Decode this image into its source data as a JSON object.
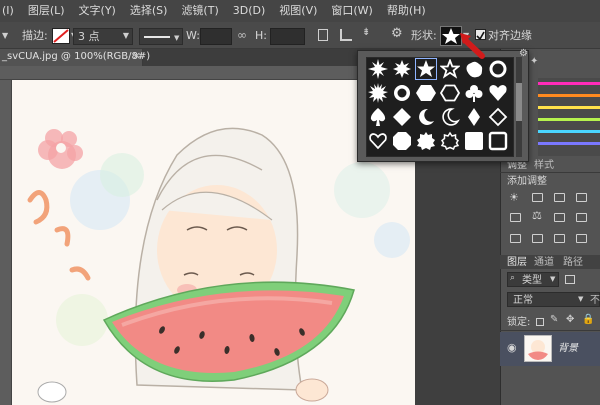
{
  "menubar": {
    "items": [
      "(I)",
      "图层(L)",
      "文字(Y)",
      "选择(S)",
      "滤镜(T)",
      "3D(D)",
      "视图(V)",
      "窗口(W)",
      "帮助(H)"
    ]
  },
  "options": {
    "stroke_label": "描边:",
    "stroke_width": "3 点",
    "w_label": "W:",
    "h_label": "H:",
    "shape_label": "形状:",
    "align_label": "对齐边缘"
  },
  "document": {
    "tab_title": "_svCUA.jpg @ 100%(RGB/8#)",
    "close_symbol": "×"
  },
  "shape_picker": {
    "shapes": [
      "starburst-16",
      "starburst-12",
      "star-5",
      "star-5-outline",
      "blob",
      "circle-scalloped",
      "starburst-24",
      "gear-scalloped",
      "hexagon",
      "hexagon-outline",
      "club",
      "heart",
      "spade",
      "diamond",
      "crescent",
      "crescent-outline",
      "diamond-thin",
      "diamond-outline",
      "heart-outline",
      "octagon",
      "seal",
      "seal-outline",
      "square",
      "square-outline"
    ]
  },
  "panels": {
    "tab_adjustments": "调整",
    "tab_styles": "样式",
    "add_adjustment_label": "添加调整",
    "tab_layers": "图层",
    "tab_channels": "通道",
    "tab_paths": "路径",
    "filter_kind": "类型",
    "blend_mode": "正常",
    "opacity_label": "不",
    "lock_label": "锁定:",
    "layer_name": "背景"
  },
  "colors": {
    "swatch_bars": [
      "#ff2bb8",
      "#ff8a1f",
      "#ffe14a",
      "#b6f24e",
      "#4ad6ff",
      "#7a78ff"
    ],
    "arrow": "#d21b1b"
  }
}
